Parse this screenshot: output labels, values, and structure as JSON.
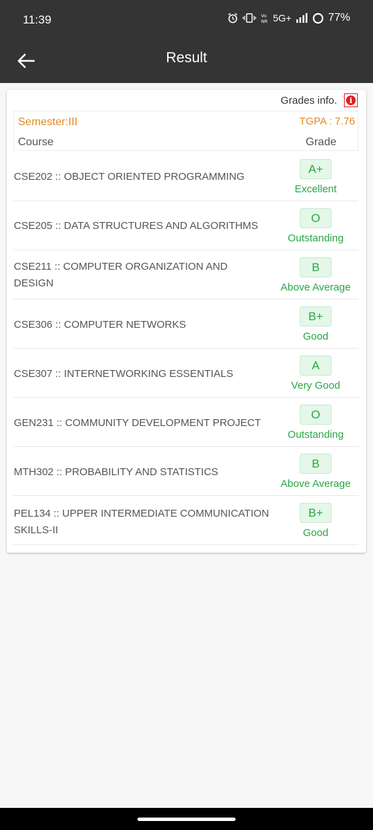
{
  "status_bar": {
    "time": "11:39",
    "network": "5G+",
    "battery": "77%"
  },
  "app_bar": {
    "title": "Result"
  },
  "card": {
    "grades_info_label": "Grades info.",
    "semester": "Semester:III",
    "tgpa": "TGPA : 7.76",
    "col_course": "Course",
    "col_grade": "Grade",
    "courses": [
      {
        "name": "CSE202 :: OBJECT ORIENTED PROGRAMMING",
        "grade": "A+",
        "remark": "Excellent"
      },
      {
        "name": "CSE205 :: DATA STRUCTURES AND ALGORITHMS",
        "grade": "O",
        "remark": "Outstanding"
      },
      {
        "name": "CSE211 :: COMPUTER ORGANIZATION AND DESIGN",
        "grade": "B",
        "remark": "Above Average"
      },
      {
        "name": "CSE306 :: COMPUTER NETWORKS",
        "grade": "B+",
        "remark": "Good"
      },
      {
        "name": "CSE307 :: INTERNETWORKING ESSENTIALS",
        "grade": "A",
        "remark": "Very Good"
      },
      {
        "name": "GEN231 :: COMMUNITY DEVELOPMENT PROJECT",
        "grade": "O",
        "remark": "Outstanding"
      },
      {
        "name": "MTH302 :: PROBABILITY AND STATISTICS",
        "grade": "B",
        "remark": "Above Average"
      },
      {
        "name": "PEL134 :: UPPER INTERMEDIATE COMMUNICATION SKILLS-II",
        "grade": "B+",
        "remark": "Good"
      }
    ]
  },
  "colors": {
    "app_bar": "#343434",
    "accent_orange": "#e58a1f",
    "grade_green": "#28a745",
    "grade_bg": "#e4f7e8",
    "info_red": "#e02020"
  }
}
